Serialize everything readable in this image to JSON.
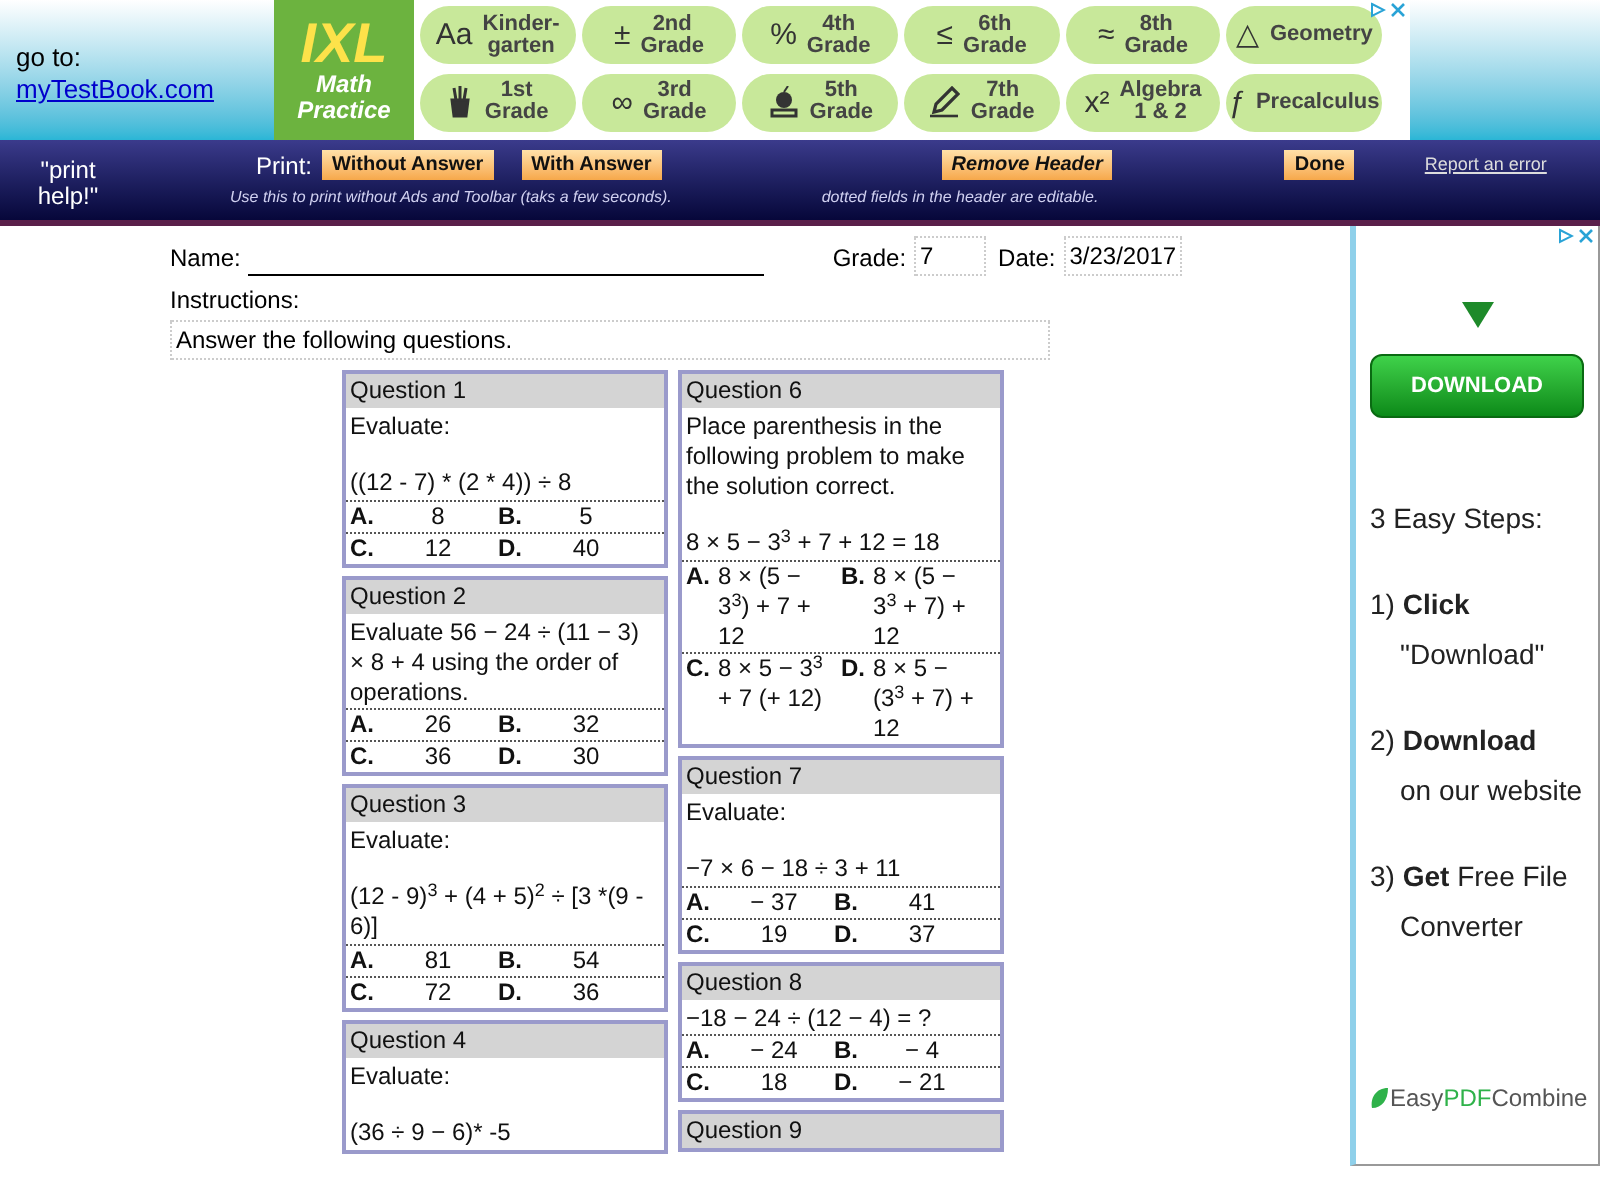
{
  "goto": {
    "label": "go to:",
    "link": "myTestBook.com"
  },
  "ad_top": {
    "logo_top": "IXL",
    "logo_bottom": "Math Practice",
    "pills": [
      {
        "kind": "symbol",
        "symbol": "Aa",
        "label": "Kinder-\ngarten"
      },
      {
        "kind": "symbol",
        "symbol": "±",
        "label": "2nd\nGrade"
      },
      {
        "kind": "symbol",
        "symbol": "%",
        "label": "4th\nGrade"
      },
      {
        "kind": "symbol",
        "symbol": "≤",
        "label": "6th\nGrade"
      },
      {
        "kind": "symbol",
        "symbol": "≈",
        "label": "8th\nGrade"
      },
      {
        "kind": "symbol",
        "symbol": "△",
        "label": "Geometry"
      },
      {
        "kind": "cup",
        "label": "1st\nGrade"
      },
      {
        "kind": "symbol",
        "symbol": "∞",
        "label": "3rd\nGrade"
      },
      {
        "kind": "apple",
        "label": "5th\nGrade"
      },
      {
        "kind": "pencil",
        "label": "7th\nGrade"
      },
      {
        "kind": "symbol",
        "symbol": "x²",
        "label": "Algebra\n1 & 2"
      },
      {
        "kind": "symbol",
        "symbol": "ƒ",
        "label": "Precalculus"
      }
    ]
  },
  "toolbar": {
    "help": "\"print\nhelp!\"",
    "print_label": "Print:",
    "buttons": [
      {
        "label": "Without Answer",
        "italic": false
      },
      {
        "label": "With Answer",
        "italic": false
      },
      {
        "label": "Remove Header",
        "italic": true
      },
      {
        "label": "Done",
        "italic": false
      }
    ],
    "hint_left": "Use this to print without Ads and Toolbar (taks a few seconds).",
    "hint_right": "dotted fields in the header are editable.",
    "report_link": "Report an error"
  },
  "header": {
    "name_label": "Name:",
    "grade_label": "Grade:",
    "grade": "7",
    "date_label": "Date:",
    "date": "3/23/2017",
    "instructions_label": "Instructions:",
    "instructions": "Answer the following questions."
  },
  "columns": [
    [
      {
        "title": "Question 1",
        "prompt": "Evaluate:",
        "expression": "((12 - 7) * (2 * 4)) ÷ 8",
        "options": [
          {
            "letter": "A.",
            "value": "8"
          },
          {
            "letter": "B.",
            "value": "5"
          },
          {
            "letter": "C.",
            "value": "12"
          },
          {
            "letter": "D.",
            "value": "40"
          }
        ]
      },
      {
        "title": "Question 2",
        "prompt": "Evaluate 56 − 24 ÷ (11 − 3) × 8 + 4 using the order of operations.",
        "options": [
          {
            "letter": "A.",
            "value": "26"
          },
          {
            "letter": "B.",
            "value": "32"
          },
          {
            "letter": "C.",
            "value": "36"
          },
          {
            "letter": "D.",
            "value": "30"
          }
        ]
      },
      {
        "title": "Question 3",
        "prompt": "Evaluate:",
        "expression": "(12 - 9)$^{3}$ + (4 + 5)$^{2}$ ÷ [3 *(9 - 6)]",
        "options": [
          {
            "letter": "A.",
            "value": "81"
          },
          {
            "letter": "B.",
            "value": "54"
          },
          {
            "letter": "C.",
            "value": "72"
          },
          {
            "letter": "D.",
            "value": "36"
          }
        ]
      },
      {
        "title": "Question 4",
        "prompt": "Evaluate:",
        "expression": "(36 ÷ 9 − 6)* -5"
      }
    ],
    [
      {
        "title": "Question 6",
        "prompt": "Place parenthesis in the following problem to make the solution correct.",
        "expression": "8 × 5 − 3$^{3}$ + 7 + 12 = 18",
        "wide_options": true,
        "options": [
          {
            "letter": "A.",
            "value": "8 × (5 − 3$^{3}$) + 7 + 12"
          },
          {
            "letter": "B.",
            "value": "8 × (5 − 3$^{3}$ + 7) + 12"
          },
          {
            "letter": "C.",
            "value": "8 × 5 − 3$^{3}$ + 7 (+ 12)"
          },
          {
            "letter": "D.",
            "value": "8 × 5 − (3$^{3}$ + 7) + 12"
          }
        ]
      },
      {
        "title": "Question 7",
        "prompt": "Evaluate:",
        "expression": "−7 × 6 − 18 ÷ 3 + 11",
        "options": [
          {
            "letter": "A.",
            "value": "− 37"
          },
          {
            "letter": "B.",
            "value": "41"
          },
          {
            "letter": "C.",
            "value": "19"
          },
          {
            "letter": "D.",
            "value": "37"
          }
        ]
      },
      {
        "title": "Question 8",
        "prompt": "−18 − 24 ÷ (12 − 4) = ?",
        "options": [
          {
            "letter": "A.",
            "value": "− 24"
          },
          {
            "letter": "B.",
            "value": "− 4"
          },
          {
            "letter": "C.",
            "value": "18"
          },
          {
            "letter": "D.",
            "value": "− 21"
          }
        ]
      },
      {
        "title": "Question 9"
      }
    ]
  ],
  "ad_side": {
    "button": "DOWNLOAD",
    "heading": "3 Easy Steps:",
    "steps": [
      {
        "head": "1) **Click**",
        "detail": "\"Download\""
      },
      {
        "head": "2) **Download**",
        "detail": "on our website"
      },
      {
        "head": "3) **Get** Free File",
        "detail": "Converter"
      }
    ],
    "logo_parts": [
      "Easy",
      "PDF",
      "Combine"
    ]
  }
}
